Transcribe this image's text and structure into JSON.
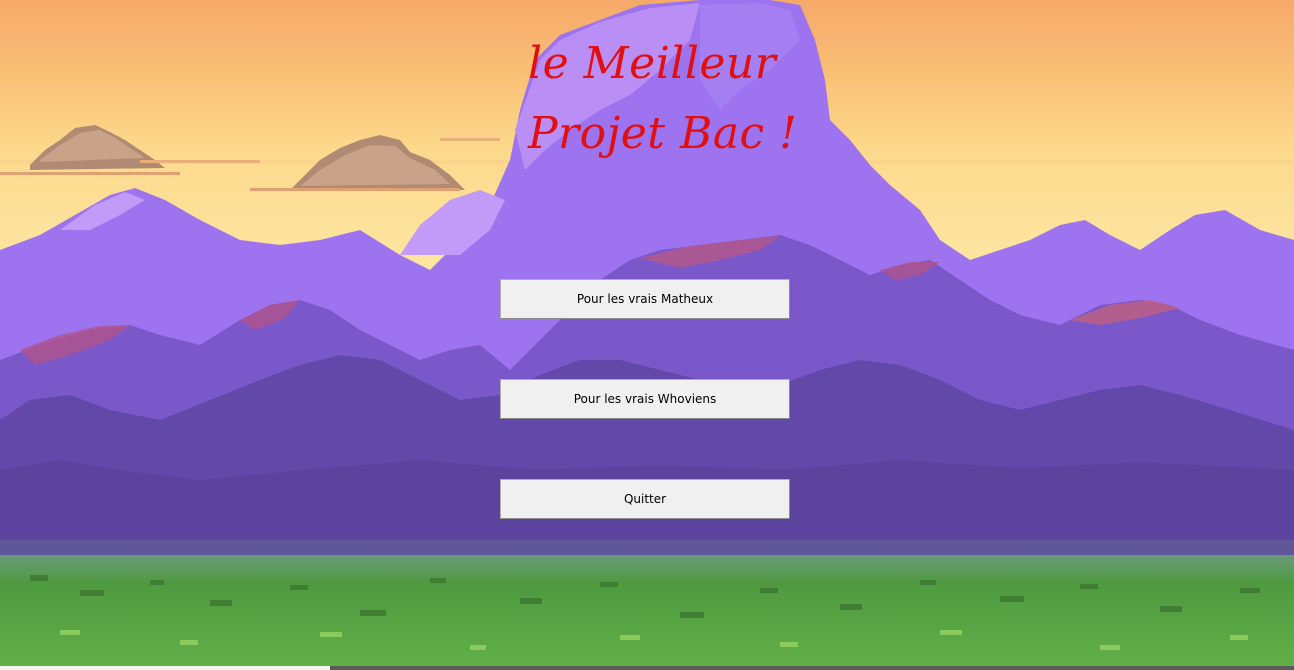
{
  "window": {
    "title_line_1": "le Meilleur",
    "title_line_2": "Projet Bac !"
  },
  "menu": {
    "buttons": [
      {
        "label": "Pour les vrais Matheux"
      },
      {
        "label": "Pour les vrais Whoviens"
      },
      {
        "label": "Quitter"
      }
    ]
  },
  "colors": {
    "title": "#e10f0f",
    "button_bg": "#f0f0f0",
    "sky_top": "#f7b26e",
    "sky_bottom": "#fde7a0",
    "mountain_light": "#9b6cf2",
    "mountain_dark": "#5d48a0",
    "grass": "#4f9a3f"
  },
  "icons": {
    "background": "pixel-art-mountain-landscape"
  }
}
